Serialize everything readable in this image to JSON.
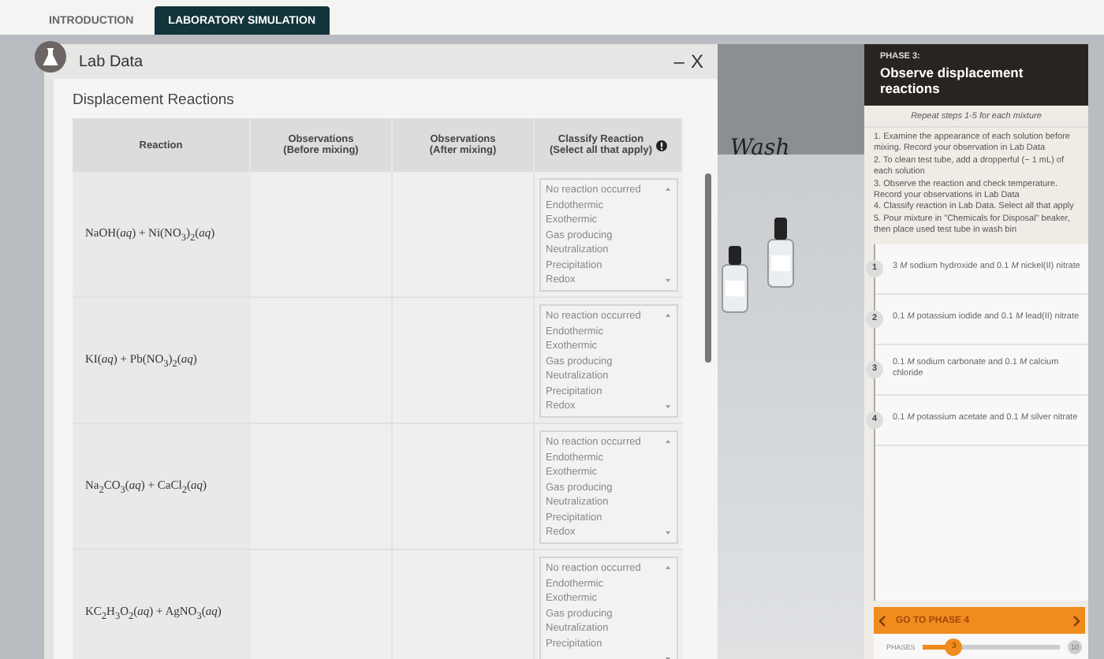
{
  "tabs": [
    {
      "label": "INTRODUCTION",
      "selected": false
    },
    {
      "label": "LABORATORY SIMULATION",
      "selected": true
    }
  ],
  "lab_window": {
    "title": "Lab Data",
    "minimize": "–",
    "close": "X",
    "heading": "Displacement Reactions",
    "columns": [
      "Reaction",
      "Observations\n(Before mixing)",
      "Observations\n(After mixing)",
      "Classify Reaction\n(Select all that apply)"
    ],
    "rows": [
      {
        "reaction": "NaOH(*aq*) + Ni(NO$_{3}$)$_{2}$(*aq*)",
        "options": [
          {
            "label": "No reaction occurred",
            "selected": false
          },
          {
            "label": "Endothermic",
            "selected": false
          },
          {
            "label": "Exothermic",
            "selected": false
          },
          {
            "label": "Gas producing",
            "selected": false
          },
          {
            "label": "Neutralization",
            "selected": false
          },
          {
            "label": "Precipitation",
            "selected": false
          },
          {
            "label": "Redox",
            "selected": false
          }
        ]
      },
      {
        "reaction": "KI(*aq*) + Pb(NO$_{3}$)$_{2}$(*aq*)",
        "options": [
          {
            "label": "No reaction occurred",
            "selected": false
          },
          {
            "label": "Endothermic",
            "selected": false
          },
          {
            "label": "Exothermic",
            "selected": false
          },
          {
            "label": "Gas producing",
            "selected": false
          },
          {
            "label": "Neutralization",
            "selected": false
          },
          {
            "label": "Precipitation",
            "selected": false
          },
          {
            "label": "Redox",
            "selected": false
          }
        ]
      },
      {
        "reaction": "Na$_{2}$CO$_{3}$(*aq*) + CaCl$_{2}$(*aq*)",
        "options": [
          {
            "label": "No reaction occurred",
            "selected": false
          },
          {
            "label": "Endothermic",
            "selected": false
          },
          {
            "label": "Exothermic",
            "selected": false
          },
          {
            "label": "Gas producing",
            "selected": false
          },
          {
            "label": "Neutralization",
            "selected": false
          },
          {
            "label": "Precipitation",
            "selected": false
          },
          {
            "label": "Redox",
            "selected": false
          }
        ]
      },
      {
        "reaction": "KC$_{2}$H$_{3}$O$_{2}$(*aq*) + AgNO$_{3}$(*aq*)",
        "options": [
          {
            "label": "No reaction occurred",
            "selected": false
          },
          {
            "label": "Endothermic",
            "selected": false
          },
          {
            "label": "Exothermic",
            "selected": false
          },
          {
            "label": "Gas producing",
            "selected": false
          },
          {
            "label": "Neutralization",
            "selected": false
          },
          {
            "label": "Precipitation",
            "selected": false
          }
        ]
      }
    ]
  },
  "scene": {
    "label": "Wash"
  },
  "phase_panel": {
    "phase": "PHASE 3:",
    "title": "Observe displacement reactions",
    "subtitle": "Repeat steps 1-5 for each mixture",
    "steps": [
      "1. Examine the appearance of each solution before mixing. Record your observation in Lab Data",
      "2. To clean test tube, add a dropperful (~ 1 mL) of each solution",
      "3. Observe the reaction and check temperature. Record your observations in Lab Data",
      "4. Classify reaction in Lab Data. Select all that apply",
      "5. Pour mixture in \"Chemicals for Disposal\" beaker, then place used test tube in wash bin"
    ],
    "mixtures": [
      {
        "number": "1",
        "text": "3 *M* sodium hydroxide and 0.1 *M* nickel(II) nitrate"
      },
      {
        "number": "2",
        "text": "0.1 *M* potassium iodide and 0.1 *M* lead(II) nitrate"
      },
      {
        "number": "3",
        "text": "0.1 *M* sodium carbonate and 0.1 *M* calcium chloride"
      },
      {
        "number": "4",
        "text": "0.1 *M* potassium acetate and 0.1 *M* silver nitrate"
      }
    ],
    "next_button": "GO TO PHASE 4",
    "phases": {
      "label": "PHASES",
      "current": "3",
      "last": "10",
      "level": 0.22
    }
  }
}
